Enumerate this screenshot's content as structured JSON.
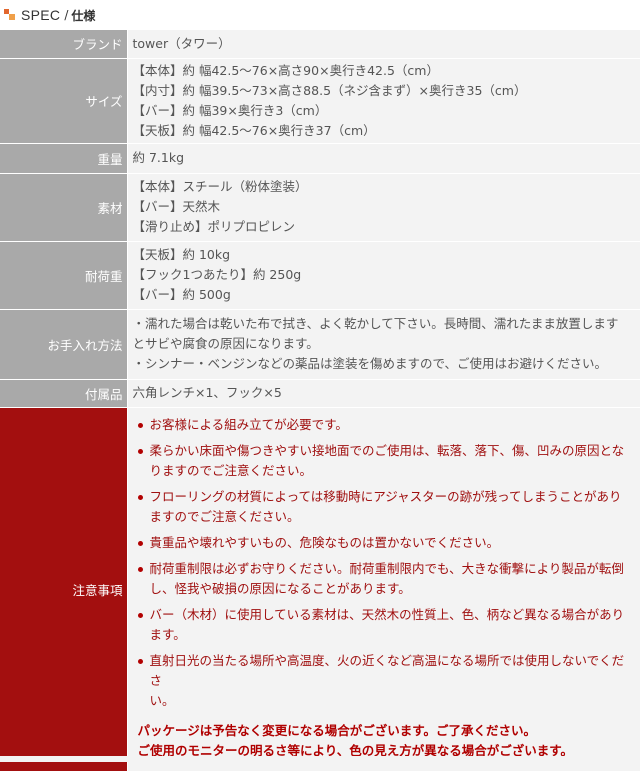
{
  "header": {
    "title_en": "SPEC",
    "separator": "/",
    "title_ja": "仕様"
  },
  "rows": [
    {
      "label": "ブランド",
      "lines": [
        "tower（タワー）"
      ]
    },
    {
      "label": "サイズ",
      "lines": [
        "【本体】約 幅42.5～76×高さ90×奥行き42.5（cm）",
        "【内寸】約 幅39.5～73×高さ88.5（ネジ含まず）×奥行き35（cm）",
        "【バー】約 幅39×奥行き3（cm）",
        "【天板】約 幅42.5～76×奥行き37（cm）"
      ]
    },
    {
      "label": "重量",
      "lines": [
        "約 7.1kg"
      ]
    },
    {
      "label": "素材",
      "lines": [
        "【本体】スチール（粉体塗装）",
        "【バー】天然木",
        "【滑り止め】ポリプロピレン"
      ]
    },
    {
      "label": "耐荷重",
      "lines": [
        "【天板】約 10kg",
        "【フック1つあたり】約 250g",
        "【バー】約 500g"
      ]
    },
    {
      "label": "お手入れ方法",
      "lines": [
        "・濡れた場合は乾いた布で拭き、よく乾かして下さい。長時間、濡れたまま放置します",
        "とサビや腐食の原因になります。",
        "・シンナー・ベンジンなどの薬品は塗装を傷めますので、ご使用はお避けください。"
      ]
    },
    {
      "label": "付属品",
      "lines": [
        "六角レンチ×1、フック×5"
      ]
    }
  ],
  "notes": {
    "label": "注意事項",
    "items": [
      [
        "お客様による組み立てが必要です。"
      ],
      [
        "柔らかい床面や傷つきやすい接地面でのご使用は、転落、落下、傷、凹みの原因とな",
        "りますのでご注意ください。"
      ],
      [
        "フローリングの材質によっては移動時にアジャスターの跡が残ってしまうことがあり",
        "ますのでご注意ください。"
      ],
      [
        "貴重品や壊れやすいもの、危険なものは置かないでください。"
      ],
      [
        "耐荷重制限は必ずお守りください。耐荷重制限内でも、大きな衝撃により製品が転倒",
        "し、怪我や破損の原因になることがあります。"
      ],
      [
        "バー（木材）に使用している素材は、天然木の性質上、色、柄など異なる場合があり",
        "ます。"
      ],
      [
        "直射日光の当たる場所や高温度、火の近くなど高温になる場所では使用しないでくださ",
        "い。"
      ]
    ],
    "footer_lines": [
      "パッケージは予告なく変更になる場合がございます。ご了承ください。",
      "ご使用のモニターの明るさ等により、色の見え方が異なる場合がございます。"
    ]
  },
  "colors": {
    "label_bg": "#a9a9a9",
    "notes_label_bg": "#a30f0f",
    "value_bg": "#f3f3f3",
    "caution_text": "#a01010",
    "accent": "#e2662d"
  }
}
